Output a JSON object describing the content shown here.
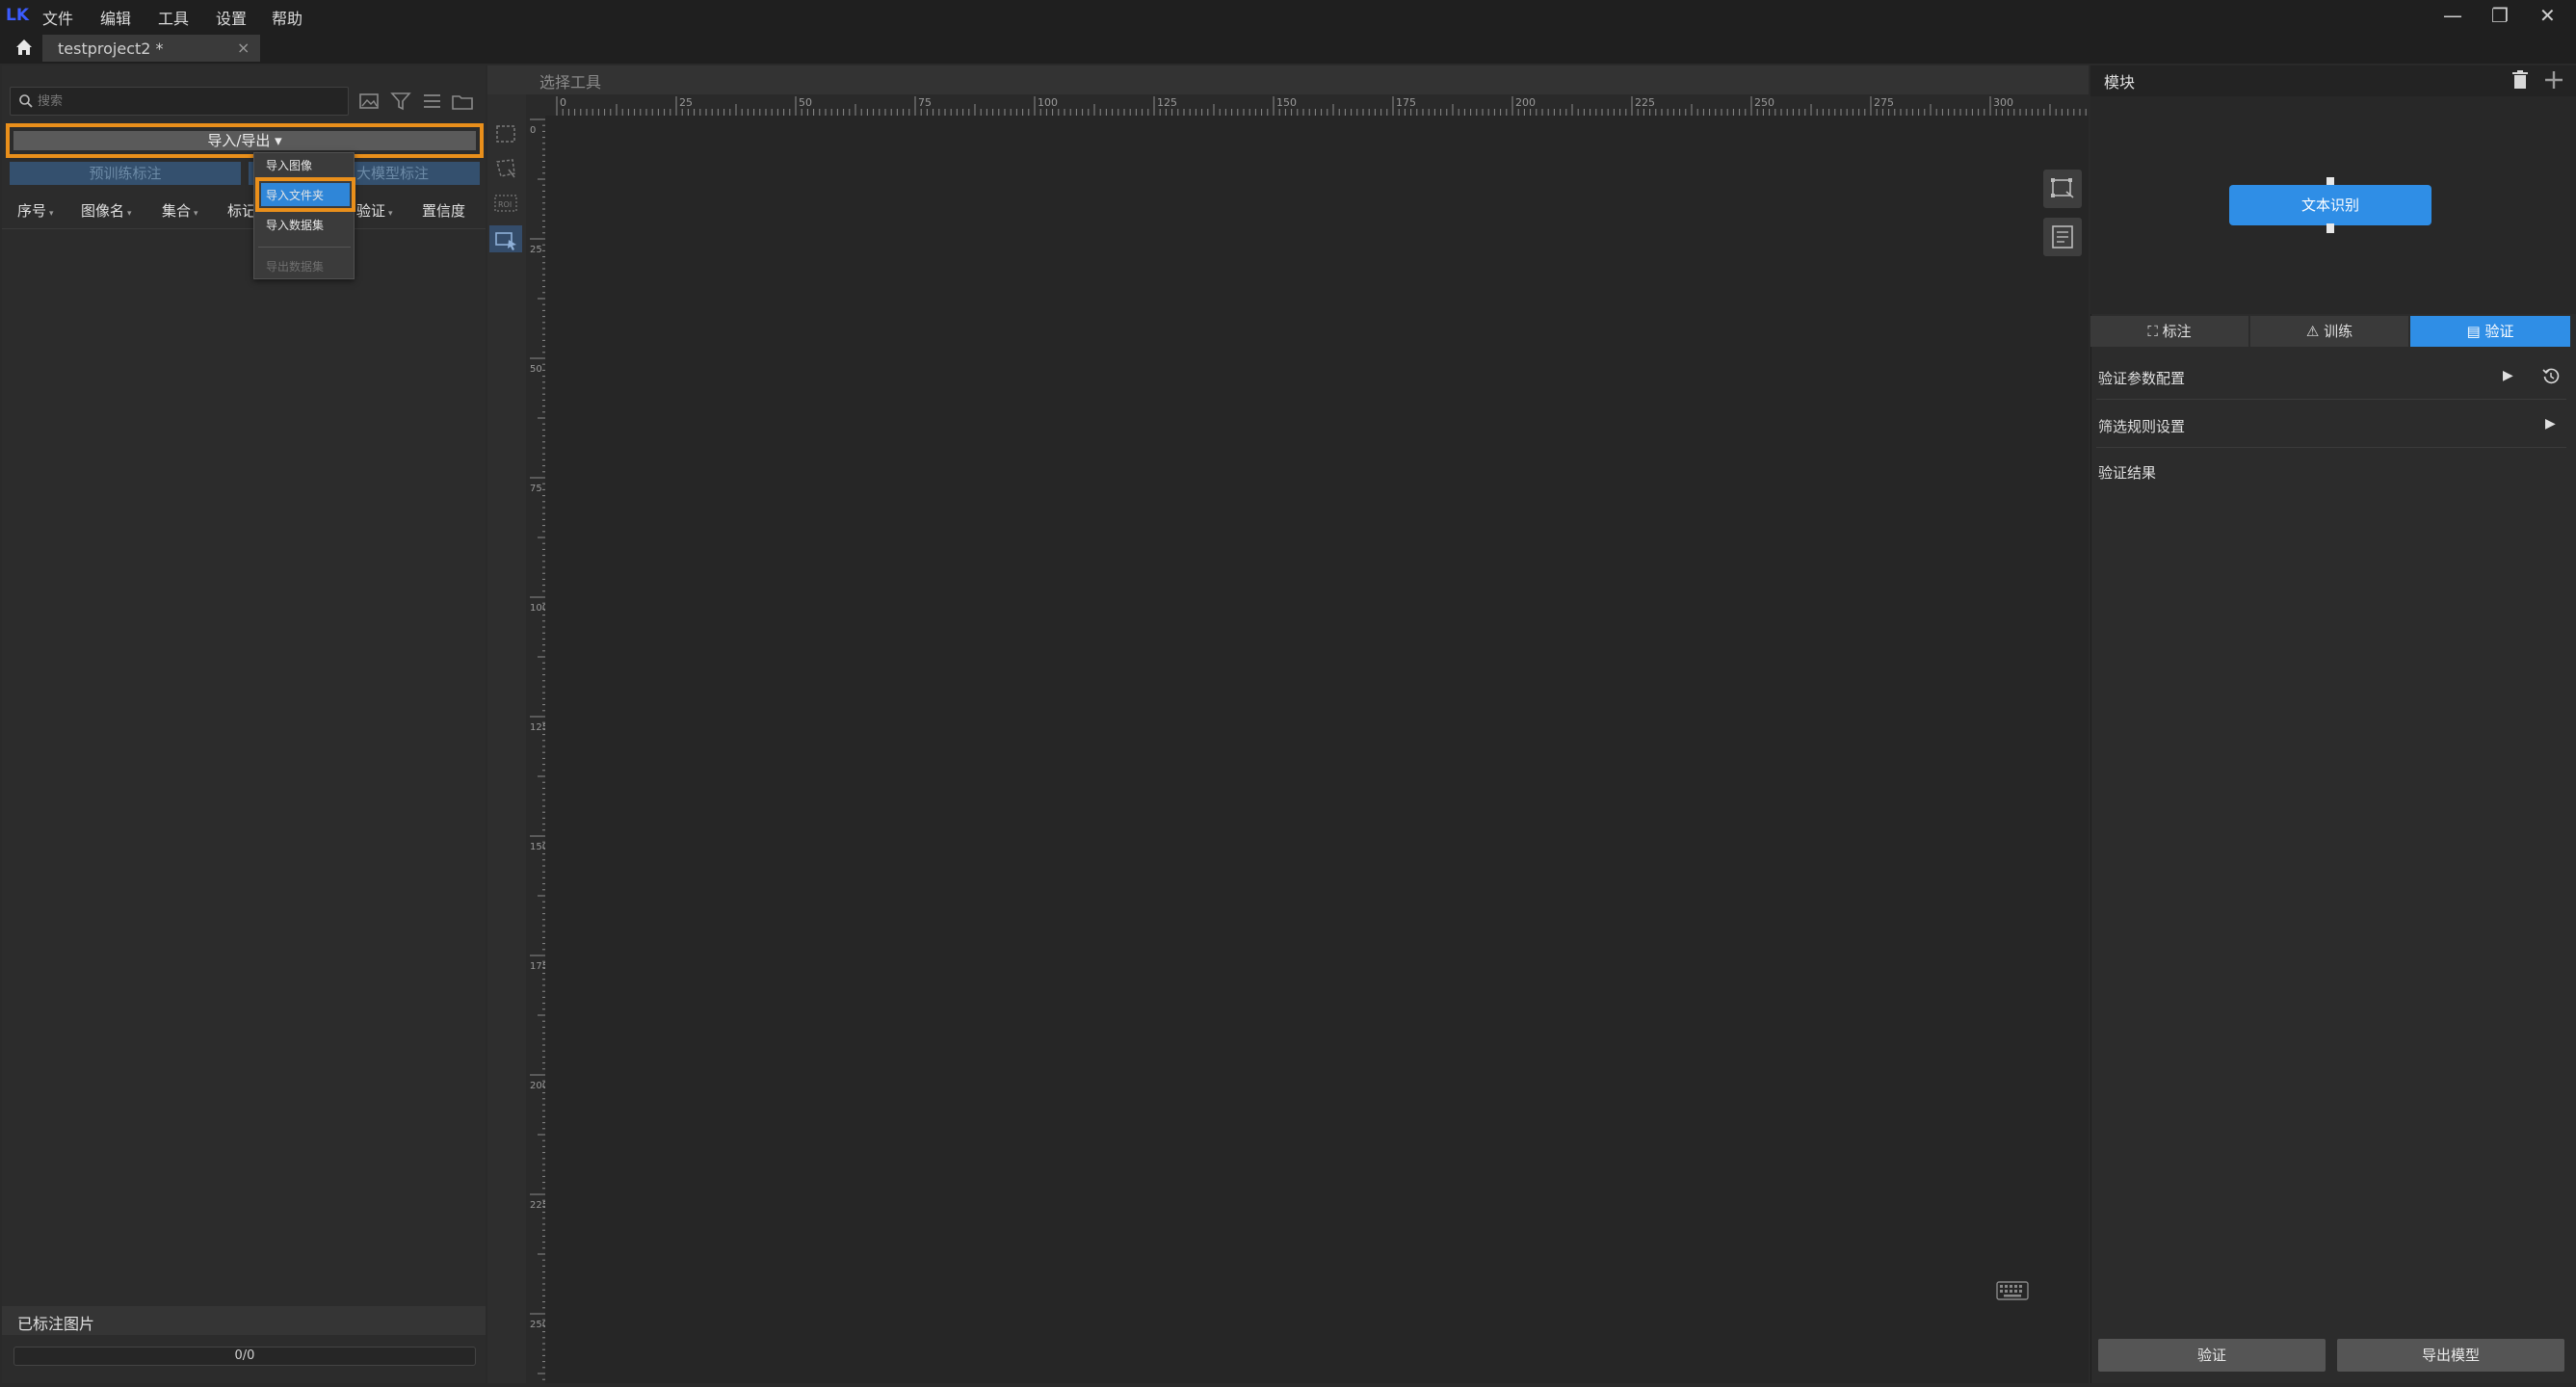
{
  "app": {
    "logo": "LK",
    "menu": [
      "文件",
      "编辑",
      "工具",
      "设置",
      "帮助"
    ],
    "window_controls": [
      "—",
      "❐",
      "✕"
    ]
  },
  "tabs": [
    {
      "label": "testproject2 *",
      "close": "×"
    }
  ],
  "left_panel": {
    "search_placeholder": "搜索",
    "import_export_label": "导入/导出 ▾",
    "pretrain_label": "预训练标注",
    "bigmodel_label": "大模型标注",
    "columns": [
      "序号",
      "图像名",
      "集合",
      "标记",
      "验证",
      "置信度"
    ],
    "dropdown": [
      "导入图像",
      "导入文件夹",
      "导入数据集",
      "导出数据集"
    ],
    "labeled_images_label": "已标注图片",
    "progress_text": "0/0"
  },
  "center": {
    "tool_title": "选择工具",
    "tools": [
      "rect-select-icon",
      "poly-select-icon",
      "roi-icon",
      "select-cursor-icon"
    ],
    "roi_label": "ROI",
    "ruler_labels": [
      "0",
      "25",
      "50",
      "75",
      "100",
      "125",
      "150",
      "175",
      "200",
      "225",
      "250",
      "275",
      "300"
    ],
    "vruler_labels": [
      "0",
      "25",
      "50",
      "75",
      "100",
      "125",
      "150",
      "175",
      "200",
      "225",
      "250"
    ]
  },
  "right_panel": {
    "module_title": "模块",
    "module_node": "文本识别",
    "tabs": [
      "标注",
      "训练",
      "验证"
    ],
    "sections": [
      "验证参数配置",
      "筛选规则设置",
      "验证结果"
    ],
    "buttons": [
      "验证",
      "导出模型"
    ]
  },
  "colors": {
    "accent": "#2f8ee6",
    "highlight": "#e98f1b",
    "background": "#2a2a2a"
  }
}
